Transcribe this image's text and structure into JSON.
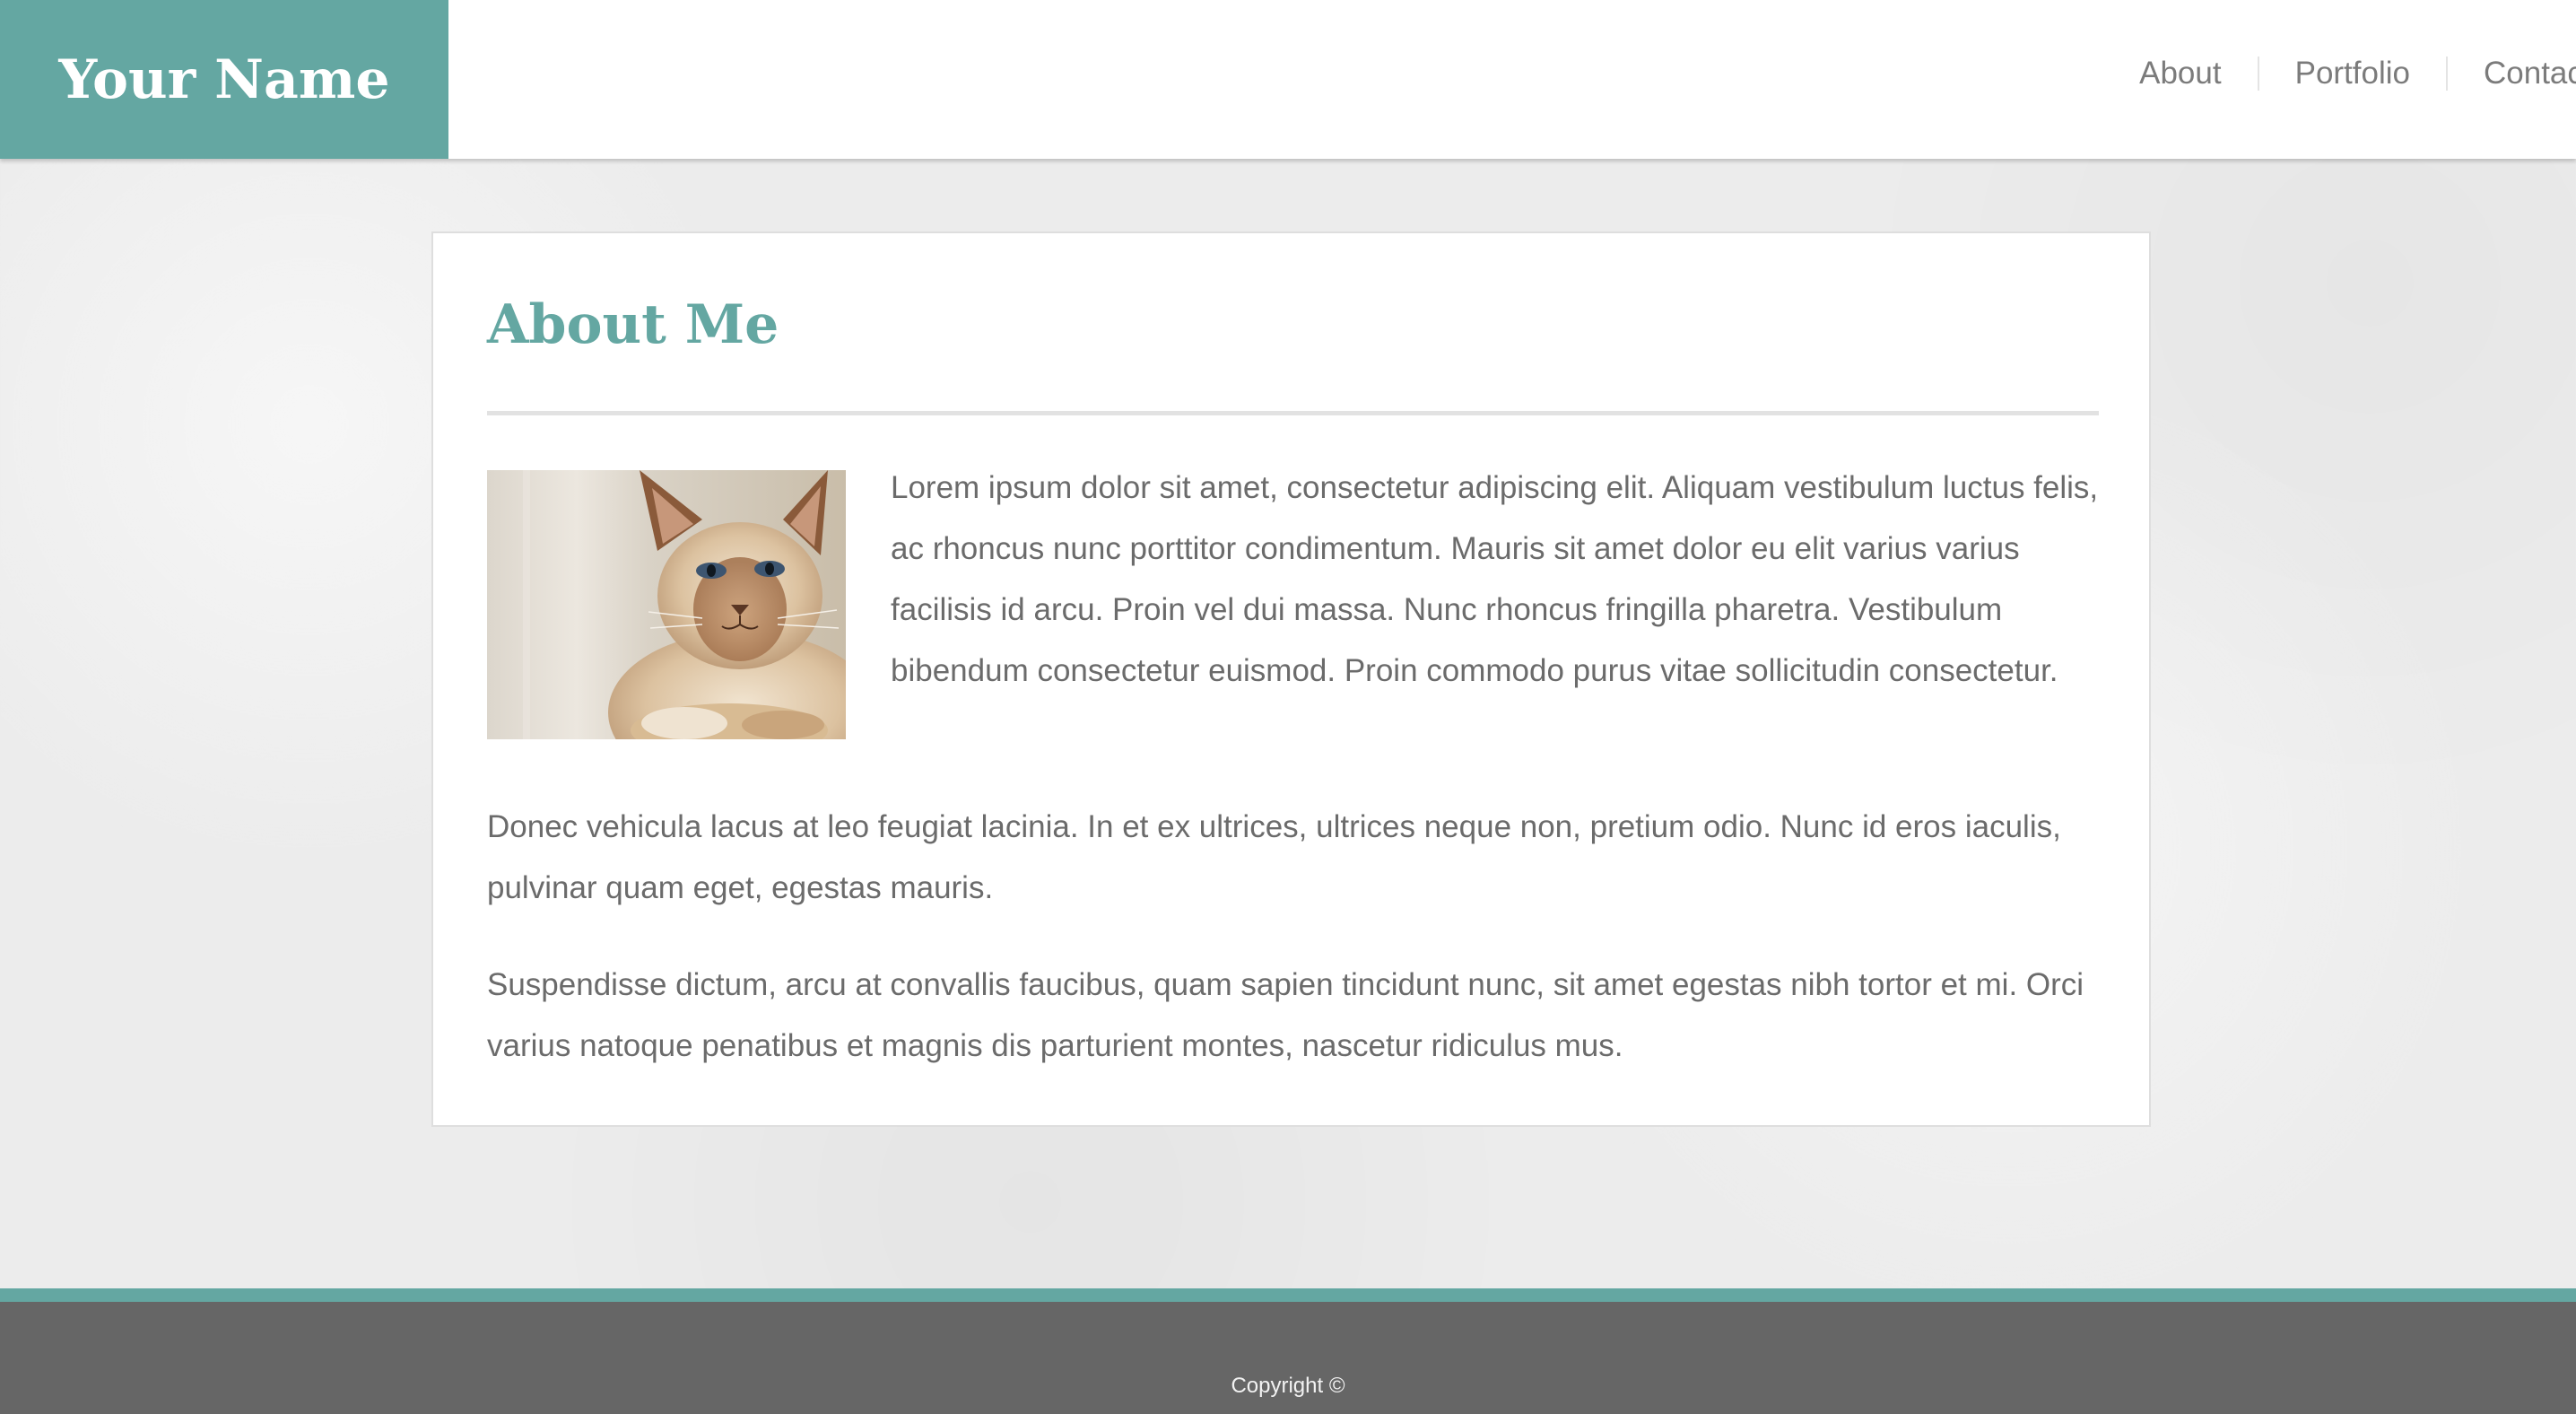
{
  "header": {
    "logo_text": "Your Name",
    "nav": [
      {
        "label": "About"
      },
      {
        "label": "Portfolio"
      },
      {
        "label": "Contact"
      }
    ]
  },
  "main": {
    "title": "About Me",
    "photo_icon": "cat-photo",
    "paragraphs": [
      "Lorem ipsum dolor sit amet, consectetur adipiscing elit. Aliquam vestibulum luctus felis, ac rhoncus nunc porttitor condimentum. Mauris sit amet dolor eu elit varius varius facilisis id arcu. Proin vel dui massa. Nunc rhoncus fringilla pharetra. Vestibulum bibendum consectetur euismod. Proin commodo purus vitae sollicitudin consectetur.",
      "Donec vehicula lacus at leo feugiat lacinia. In et ex ultrices, ultrices neque non, pretium odio. Nunc id eros iaculis, pulvinar quam eget, egestas mauris.",
      "Suspendisse dictum, arcu at convallis faucibus, quam sapien tincidunt nunc, sit amet egestas nibh tortor et mi. Orci varius natoque penatibus et magnis dis parturient montes, nascetur ridiculus mus."
    ]
  },
  "footer": {
    "copyright": "Copyright ©"
  },
  "colors": {
    "accent": "#64a7a2",
    "footer_bg": "#666666",
    "text": "#6b6b6b",
    "nav_text": "#7b7b7b"
  }
}
